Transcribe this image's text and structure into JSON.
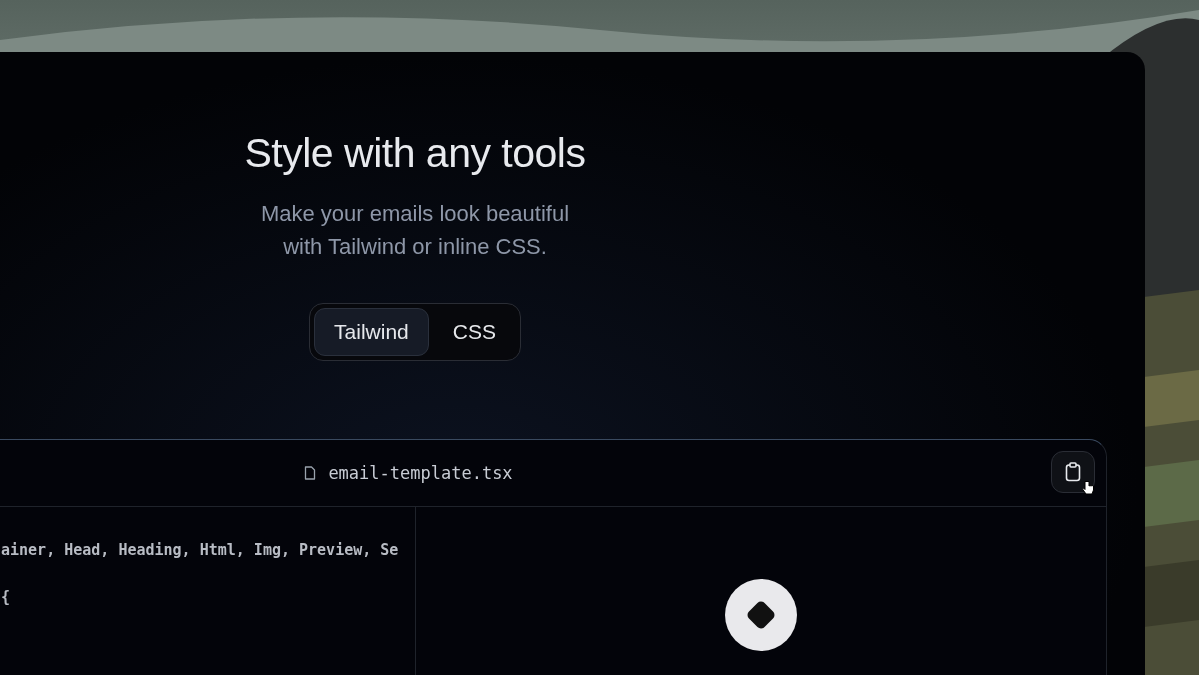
{
  "heading": "Style with any tools",
  "subtitle": [
    "Make your emails look beautiful",
    "with Tailwind or inline CSS."
  ],
  "tabs": [
    {
      "label": "Tailwind",
      "selected": true
    },
    {
      "label": "CSS",
      "selected": false
    }
  ],
  "code_panel": {
    "filename": "email-template.tsx",
    "code_lines": [
      "ainer, Head, Heading, Html, Img, Preview, Se",
      "{"
    ]
  }
}
